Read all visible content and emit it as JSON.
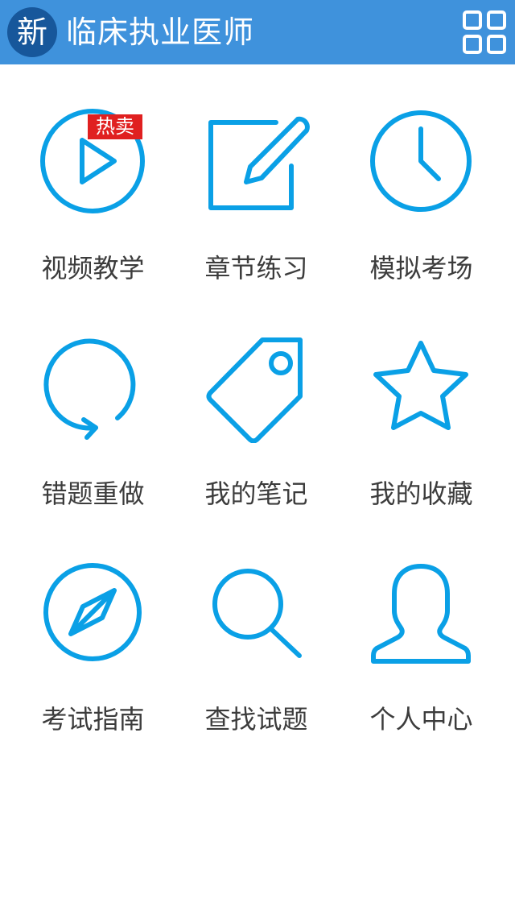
{
  "header": {
    "logo_char": "新",
    "title": "临床执业医师",
    "menu_icon": "grid-icon",
    "background": "#3f92dc",
    "logo_background": "#17579b"
  },
  "accent_color": "#0aa0e6",
  "badge_color": "#e02020",
  "menu": [
    {
      "label": "视频教学",
      "icon": "play-circle-icon",
      "badge": "热卖"
    },
    {
      "label": "章节练习",
      "icon": "pencil-edit-icon"
    },
    {
      "label": "模拟考场",
      "icon": "clock-icon"
    },
    {
      "label": "错题重做",
      "icon": "redo-circle-icon"
    },
    {
      "label": "我的笔记",
      "icon": "tag-icon"
    },
    {
      "label": "我的收藏",
      "icon": "star-icon"
    },
    {
      "label": "考试指南",
      "icon": "compass-icon"
    },
    {
      "label": "查找试题",
      "icon": "search-icon"
    },
    {
      "label": "个人中心",
      "icon": "user-icon"
    }
  ]
}
